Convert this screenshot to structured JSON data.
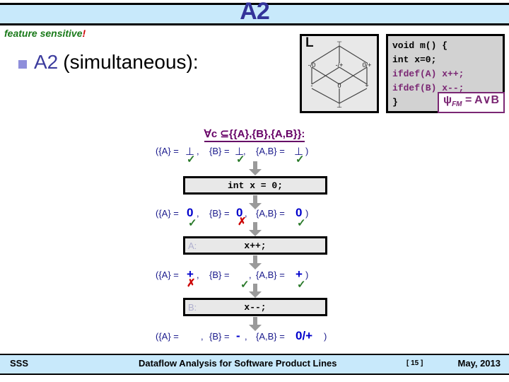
{
  "slide": {
    "title": "A2",
    "feature_tag": "feature sensitive",
    "feature_tag_bang": "!",
    "bullet_highlight": "A2",
    "bullet_rest": "(simultaneous):"
  },
  "lattice": {
    "label": "L",
    "top": "⊤",
    "bottom": "⊥",
    "upper_nodes": [
      "-/0",
      "-/+",
      "0/+"
    ],
    "mid_nodes": [
      "-",
      "0",
      "+"
    ]
  },
  "code": {
    "lines": [
      {
        "text": "void m() {",
        "kind": "plain"
      },
      {
        "text": "  int x=0;",
        "kind": "plain"
      },
      {
        "text": "  ifdef(A) x++;",
        "kind": "preproc"
      },
      {
        "text": "  ifdef(B) x--;",
        "kind": "preproc"
      },
      {
        "text": "}",
        "kind": "plain"
      }
    ],
    "fm_label": "ψ",
    "fm_sub": "FM",
    "fm_formula": "= A∨B"
  },
  "flow": {
    "quantifier": "∀c ⊆{{A},{B},{A,B}}:",
    "labels": {
      "a": "({A} =",
      "b": "{B} =",
      "ab": "{A,B} =",
      "close": ")",
      "comma": ","
    },
    "rows": [
      {
        "id": "row-initial",
        "values": [
          "⊥",
          "⊥",
          "⊥"
        ],
        "value_kind": [
          "bot",
          "bot",
          "bot"
        ],
        "marks": [
          "✓",
          "✓",
          "✓"
        ],
        "mark_kind": [
          "ok",
          "ok",
          "ok"
        ]
      },
      {
        "id": "row-after-init",
        "values": [
          "0",
          "0",
          "0"
        ],
        "value_kind": [
          "val",
          "val",
          "val"
        ],
        "marks": [
          "✓",
          "✗",
          "✓"
        ],
        "mark_kind": [
          "ok",
          "bad",
          "ok"
        ]
      },
      {
        "id": "row-after-a",
        "values": [
          "+",
          "",
          "+"
        ],
        "value_kind": [
          "val",
          "val",
          "val"
        ],
        "marks": [
          "✗",
          "✓",
          "✓"
        ],
        "mark_kind": [
          "bad",
          "ok",
          "ok"
        ]
      },
      {
        "id": "row-after-b",
        "values": [
          "",
          "-",
          "0/+"
        ],
        "value_kind": [
          "val",
          "val",
          "val"
        ],
        "marks": [
          "",
          "",
          ""
        ],
        "mark_kind": [
          "ok",
          "ok",
          "ok"
        ]
      }
    ],
    "statements": [
      {
        "id": "stmt-init",
        "tag": "",
        "text": "int x = 0;"
      },
      {
        "id": "stmt-a",
        "tag": "A:",
        "text": "x++;"
      },
      {
        "id": "stmt-b",
        "tag": "B:",
        "text": "x--;"
      }
    ]
  },
  "footer": {
    "left": "SSS",
    "center": "Dataflow Analysis for Software Product Lines",
    "page": "[ 15 ]",
    "right": "May, 2013"
  },
  "colors": {
    "band": "#c8e9fb",
    "title": "#333399",
    "purple": "#660066",
    "green": "#2a7a2a",
    "red": "#cc0000",
    "blue_value": "#0000cc"
  }
}
